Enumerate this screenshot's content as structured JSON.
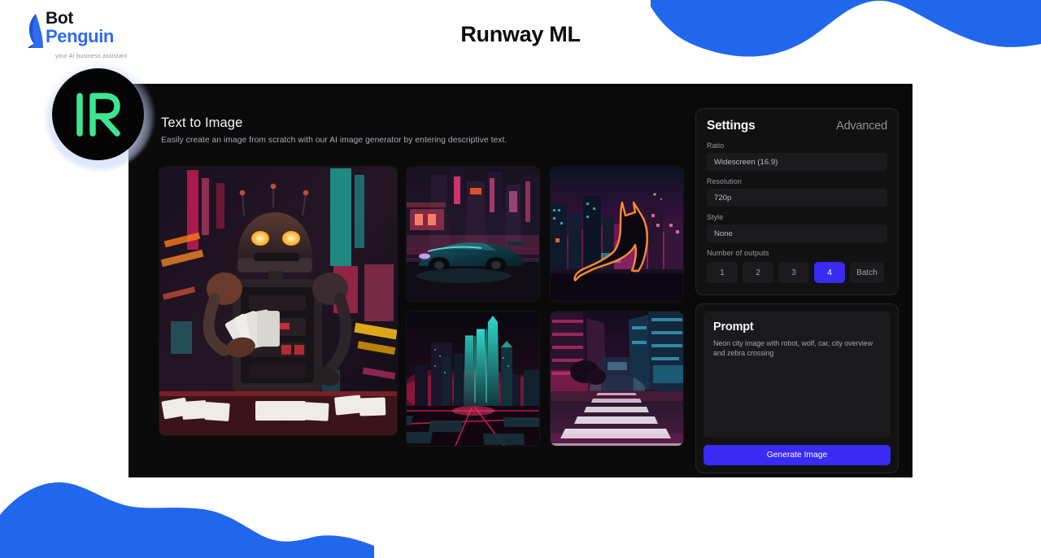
{
  "brand": {
    "name_line1": "Bot",
    "name_line2": "Penguin",
    "tagline": "your AI business assistant"
  },
  "page": {
    "title": "Runway ML"
  },
  "app": {
    "logo_badge": "runway-r-logo",
    "section": {
      "title": "Text to Image",
      "subtitle": "Easily create  an image from scratch with our AI image generator by entering descriptive text."
    },
    "gallery": [
      {
        "name": "robot-playing-cards-neon-city",
        "caption": "Robot holding playing cards in neon city"
      },
      {
        "name": "sports-car-neon-city",
        "caption": "Teal sports car on neon city street"
      },
      {
        "name": "wolf-silhouette-neon-skyline",
        "caption": "Wolf silhouette against neon skyline"
      },
      {
        "name": "neon-city-overview",
        "caption": "Neon city overview with teal towers"
      },
      {
        "name": "zebra-crossing-neon-street",
        "caption": "Zebra crossing on neon city street"
      }
    ],
    "settings": {
      "title": "Settings",
      "advanced_label": "Advanced",
      "fields": [
        {
          "label": "Ratio",
          "value": "Widescreen (16.9)"
        },
        {
          "label": "Resolution",
          "value": "720p"
        },
        {
          "label": "Style",
          "value": "None"
        }
      ],
      "outputs": {
        "label": "Number of outputs",
        "options": [
          "1",
          "2",
          "3",
          "4",
          "Batch"
        ],
        "selected": "4"
      }
    },
    "prompt": {
      "title": "Prompt",
      "text": "Neon city image with robot, wolf, car, city overview and zebra crossing",
      "generate_label": "Generate Image"
    }
  },
  "colors": {
    "brand_blue": "#2f6bf0",
    "wave_blue": "#2167ec",
    "accent_indigo": "#3a2af2",
    "runway_green": "#3ee58f",
    "canvas_black": "#0a0a0a"
  }
}
